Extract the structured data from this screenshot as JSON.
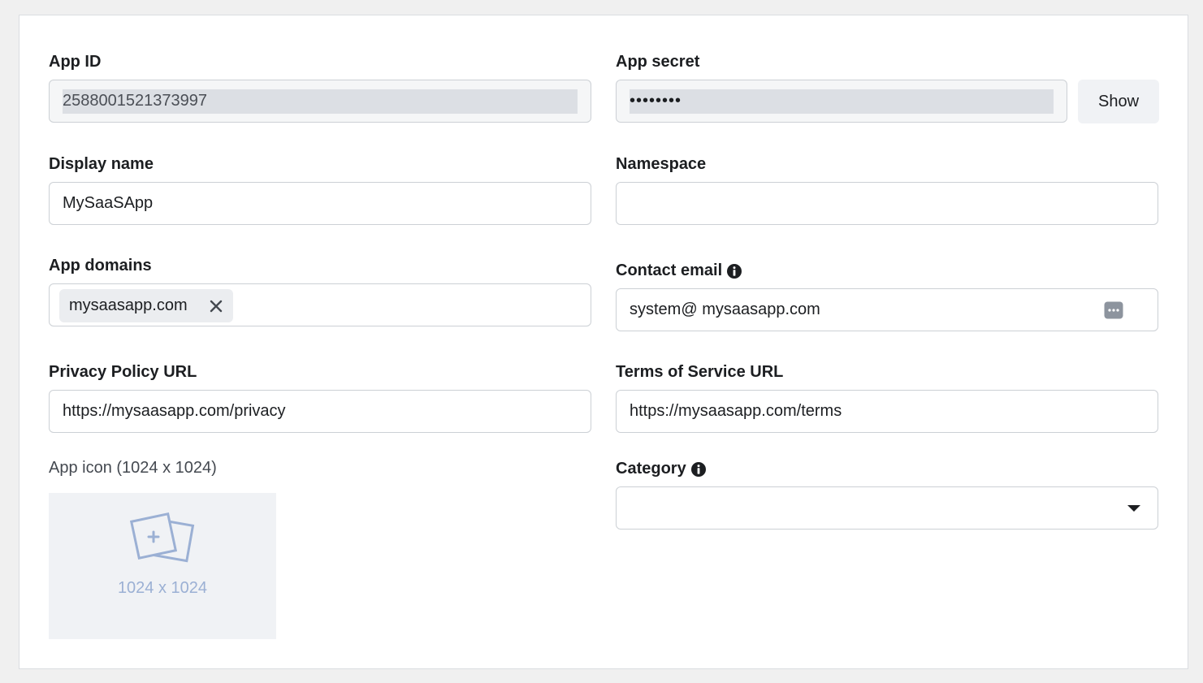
{
  "app_id": {
    "label": "App ID",
    "value": "2588001521373997"
  },
  "app_secret": {
    "label": "App secret",
    "masked_value": "••••••••",
    "show_label": "Show"
  },
  "display_name": {
    "label": "Display name",
    "value": "MySaaSApp"
  },
  "namespace": {
    "label": "Namespace",
    "value": ""
  },
  "app_domains": {
    "label": "App domains",
    "chips": [
      "mysaasapp.com"
    ]
  },
  "contact_email": {
    "label": "Contact email",
    "value": "system@ mysaasapp.com"
  },
  "privacy_policy_url": {
    "label": "Privacy Policy URL",
    "value": "https://mysaasapp.com/privacy"
  },
  "terms_of_service_url": {
    "label": "Terms of Service URL",
    "value": "https://mysaasapp.com/terms"
  },
  "app_icon": {
    "label": "App icon (1024 x 1024)",
    "placeholder_text": "1024 x 1024"
  },
  "category": {
    "label": "Category",
    "selected": ""
  },
  "colors": {
    "accent_icon": "#9bb0d4",
    "chip_bg": "#ebedf0",
    "disabled_bg": "#f5f6f7"
  }
}
